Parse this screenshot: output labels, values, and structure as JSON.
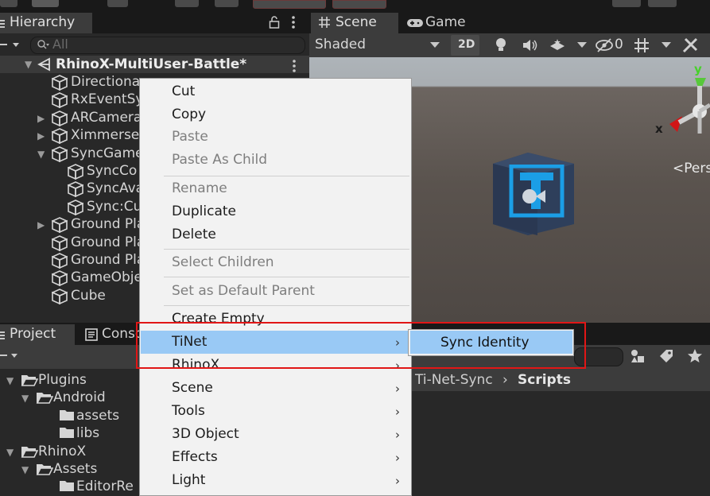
{
  "toolbar": {
    "icons": [
      "hand-icon",
      "move-icon",
      "rect-icon",
      "globe-icon"
    ]
  },
  "hierarchy": {
    "tab_label": "Hierarchy",
    "search_placeholder": "All",
    "scene_name": "RhinoX-MultiUser-Battle*",
    "items": [
      {
        "label": "Directiona",
        "depth": 1,
        "expand": "none"
      },
      {
        "label": "RxEventSy",
        "depth": 1,
        "expand": "none"
      },
      {
        "label": "ARCamera",
        "depth": 1,
        "expand": "collapsed"
      },
      {
        "label": "Ximmerse",
        "depth": 1,
        "expand": "collapsed"
      },
      {
        "label": "SyncGame",
        "depth": 1,
        "expand": "expanded"
      },
      {
        "label": "SyncCo",
        "depth": 2,
        "expand": "none"
      },
      {
        "label": "SyncAva",
        "depth": 2,
        "expand": "none"
      },
      {
        "label": "Sync:Cu",
        "depth": 2,
        "expand": "none"
      },
      {
        "label": "Ground Pla",
        "depth": 1,
        "expand": "collapsed"
      },
      {
        "label": "Ground Pla",
        "depth": 1,
        "expand": "none"
      },
      {
        "label": "Ground Pla",
        "depth": 1,
        "expand": "none"
      },
      {
        "label": "GameObje",
        "depth": 1,
        "expand": "none"
      },
      {
        "label": "Cube",
        "depth": 1,
        "expand": "none"
      }
    ]
  },
  "scene": {
    "tabs": [
      "Scene",
      "Game"
    ],
    "shading_mode": "Shaded",
    "mode_2d": "2D",
    "hidden_count": "0",
    "gizmo": {
      "y_label": "y",
      "x_label": "x",
      "projection": "<Persp"
    }
  },
  "project": {
    "tabs": [
      "Project",
      "Conso"
    ],
    "breadcrumb": [
      "Ti-Net-Sync",
      "Scripts"
    ],
    "tree": [
      {
        "label": "Plugins",
        "depth": 0,
        "expand": "expanded"
      },
      {
        "label": "Android",
        "depth": 1,
        "expand": "expanded"
      },
      {
        "label": "assets",
        "depth": 2,
        "expand": "none"
      },
      {
        "label": "libs",
        "depth": 2,
        "expand": "none"
      },
      {
        "label": "RhinoX",
        "depth": 0,
        "expand": "expanded"
      },
      {
        "label": "Assets",
        "depth": 1,
        "expand": "expanded"
      },
      {
        "label": "EditorRe",
        "depth": 2,
        "expand": "none"
      }
    ]
  },
  "context_menu": {
    "items": [
      {
        "label": "Cut",
        "enabled": true
      },
      {
        "label": "Copy",
        "enabled": true
      },
      {
        "label": "Paste",
        "enabled": false
      },
      {
        "label": "Paste As Child",
        "enabled": false
      },
      {
        "label": "Rename",
        "enabled": false
      },
      {
        "label": "Duplicate",
        "enabled": true
      },
      {
        "label": "Delete",
        "enabled": true
      },
      {
        "label": "Select Children",
        "enabled": false
      },
      {
        "label": "Set as Default Parent",
        "enabled": false
      },
      {
        "label": "Create Empty",
        "enabled": true
      },
      {
        "label": "TiNet",
        "enabled": true,
        "submenu": true,
        "highlighted": true
      },
      {
        "label": "RhinoX",
        "enabled": true,
        "submenu": true
      },
      {
        "label": "Scene",
        "enabled": true,
        "submenu": true
      },
      {
        "label": "Tools",
        "enabled": true,
        "submenu": true
      },
      {
        "label": "3D Object",
        "enabled": true,
        "submenu": true
      },
      {
        "label": "Effects",
        "enabled": true,
        "submenu": true
      },
      {
        "label": "Light",
        "enabled": true,
        "submenu": true
      }
    ],
    "submenu": {
      "items": [
        {
          "label": "Sync Identity",
          "highlighted": true
        }
      ]
    }
  },
  "colors": {
    "menu_highlight": "#99c9f5",
    "annotation_box": "#e11616",
    "panel_bg": "#282828",
    "menu_bg": "#f2f2f2"
  }
}
